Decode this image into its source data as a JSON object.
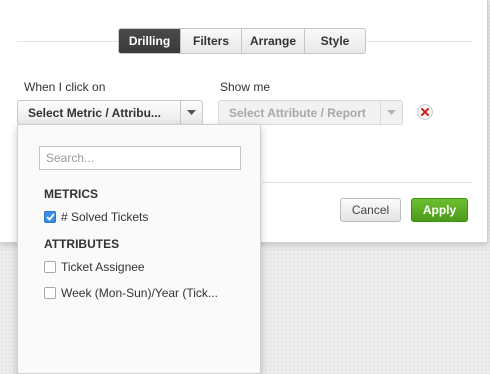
{
  "tabs": [
    "Drilling",
    "Filters",
    "Arrange",
    "Style"
  ],
  "active_tab": "Drilling",
  "when_label": "When I click on",
  "show_label": "Show me",
  "metric_select": "Select Metric / Attribu...",
  "attribute_select": "Select Attribute / Report",
  "buttons": {
    "cancel": "Cancel",
    "apply": "Apply"
  },
  "dropdown": {
    "search_placeholder": "Search...",
    "metrics_heading": "METRICS",
    "metrics": [
      {
        "label": "# Solved Tickets",
        "checked": true
      }
    ],
    "attributes_heading": "ATTRIBUTES",
    "attributes": [
      {
        "label": "Ticket Assignee",
        "checked": false
      },
      {
        "label": "Week (Mon-Sun)/Year (Tick...",
        "checked": false
      }
    ]
  },
  "colors": {
    "apply": "#58a822",
    "checkbox": "#3a8ee6",
    "remove": "#cc2222"
  }
}
